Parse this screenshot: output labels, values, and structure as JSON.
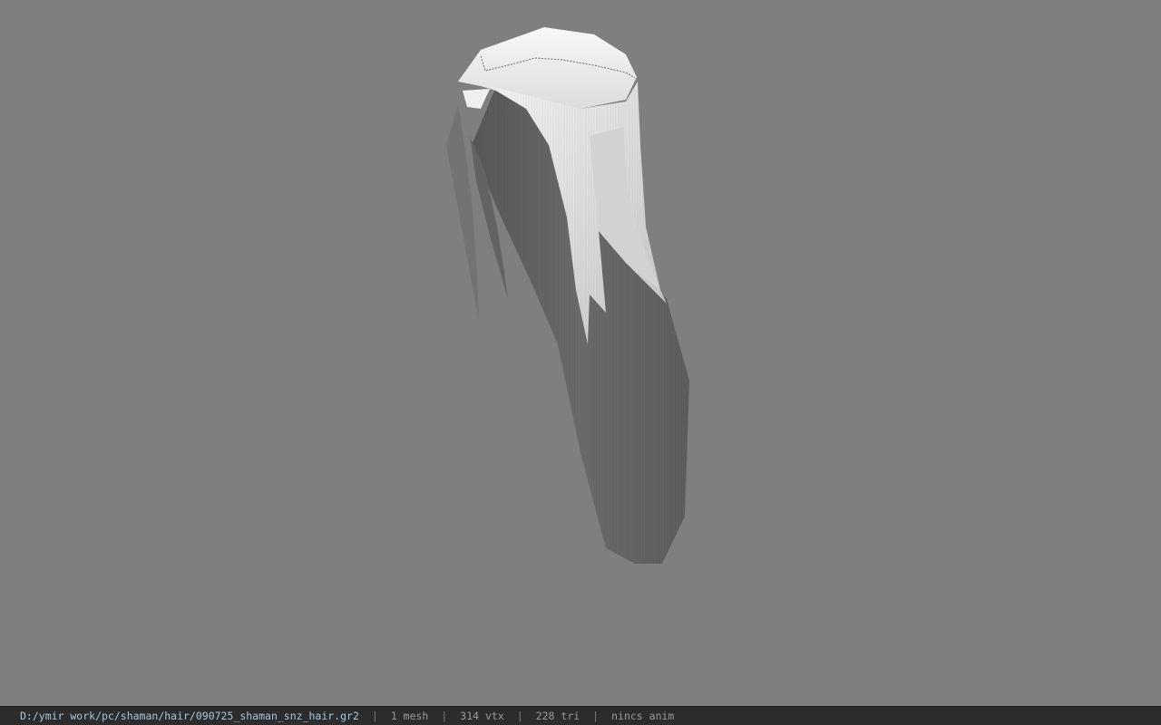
{
  "status_bar": {
    "file_path": "D:/ymir work/pc/shaman/hair/090725_shaman_snz_hair.gr2",
    "separator": "|",
    "mesh_count": "1 mesh",
    "vertex_count": "314 vtx",
    "triangle_count": "228 tri",
    "anim_status": "nincs anim"
  },
  "colors": {
    "background": "#7f7f7f",
    "status_bar": "#2c2c2c",
    "path_text": "#aac6dd",
    "info_text": "#9a9a9a"
  },
  "viewport": {
    "model": "hair mesh (grayscale)"
  }
}
